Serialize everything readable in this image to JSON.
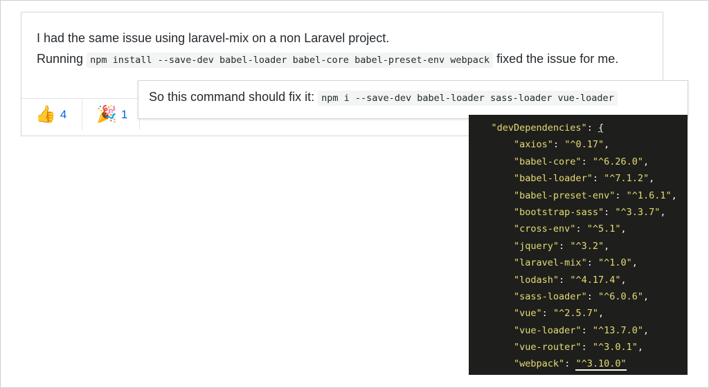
{
  "comment": {
    "line1": "I had the same issue using laravel-mix on a non Laravel project.",
    "running_prefix": "Running ",
    "command": "npm install --save-dev babel-loader babel-core babel-preset-env webpack",
    "running_suffix": " fixed the issue for me.",
    "reactions": [
      {
        "emoji": "👍",
        "count": "4"
      },
      {
        "emoji": "🎉",
        "count": "1"
      }
    ]
  },
  "overlay": {
    "text": "So this command should fix it: ",
    "command": "npm i --save-dev babel-loader sass-loader vue-loader"
  },
  "editor": {
    "root_key": "\"devDependencies\"",
    "open_brace": "{",
    "deps": [
      {
        "name": "\"axios\"",
        "version": "\"^0.17\""
      },
      {
        "name": "\"babel-core\"",
        "version": "\"^6.26.0\""
      },
      {
        "name": "\"babel-loader\"",
        "version": "\"^7.1.2\""
      },
      {
        "name": "\"babel-preset-env\"",
        "version": "\"^1.6.1\""
      },
      {
        "name": "\"bootstrap-sass\"",
        "version": "\"^3.3.7\""
      },
      {
        "name": "\"cross-env\"",
        "version": "\"^5.1\""
      },
      {
        "name": "\"jquery\"",
        "version": "\"^3.2\""
      },
      {
        "name": "\"laravel-mix\"",
        "version": "\"^1.0\""
      },
      {
        "name": "\"lodash\"",
        "version": "\"^4.17.4\""
      },
      {
        "name": "\"sass-loader\"",
        "version": "\"^6.0.6\""
      },
      {
        "name": "\"vue\"",
        "version": "\"^2.5.7\""
      },
      {
        "name": "\"vue-loader\"",
        "version": "\"^13.7.0\""
      },
      {
        "name": "\"vue-router\"",
        "version": "\"^3.0.1\""
      },
      {
        "name": "\"webpack\"",
        "version": "\"^3.10.0\""
      }
    ],
    "colors": {
      "background": "#1e1f1c",
      "string": "#e6db74",
      "punct": "#f8f8f2"
    }
  }
}
